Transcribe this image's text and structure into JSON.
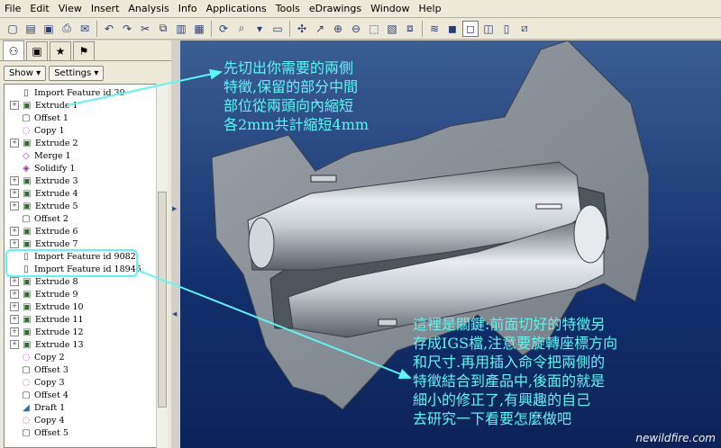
{
  "menu": [
    "File",
    "Edit",
    "View",
    "Insert",
    "Analysis",
    "Info",
    "Applications",
    "Tools",
    "eDrawings",
    "Window",
    "Help"
  ],
  "toolbar_icons": [
    "new-icon",
    "open-icon",
    "save-icon",
    "print-icon",
    "email-icon",
    "undo-icon",
    "redo-icon",
    "cut-icon",
    "copy-icon",
    "paste-icon",
    "paste-special-icon",
    "regenerate-icon",
    "find-icon",
    "select-filter-icon",
    "repaint-icon",
    "spin-center-icon",
    "orient-icon",
    "zoom-in-icon",
    "zoom-out-icon",
    "refit-icon",
    "view-manager-icon",
    "saved-views-icon",
    "layers-icon",
    "shading-icon",
    "wireframe-icon",
    "hidden-line-icon",
    "no-hidden-icon",
    "datum-planes-icon"
  ],
  "panel": {
    "tabs": [
      "model-tree-tab",
      "folder-browser-tab",
      "favorites-tab",
      "connections-tab"
    ],
    "show_button": "Show",
    "settings_button": "Settings"
  },
  "tree": [
    {
      "label": "Import Feature id 39",
      "icon": "import",
      "exp": false
    },
    {
      "label": "Extrude 1",
      "icon": "extrude",
      "exp": true
    },
    {
      "label": "Offset 1",
      "icon": "offset",
      "exp": false
    },
    {
      "label": "Copy 1",
      "icon": "copy",
      "exp": false
    },
    {
      "label": "Extrude 2",
      "icon": "extrude",
      "exp": true
    },
    {
      "label": "Merge 1",
      "icon": "merge",
      "exp": false
    },
    {
      "label": "Solidify 1",
      "icon": "solidify",
      "exp": false
    },
    {
      "label": "Extrude 3",
      "icon": "extrude",
      "exp": true
    },
    {
      "label": "Extrude 4",
      "icon": "extrude",
      "exp": true
    },
    {
      "label": "Extrude 5",
      "icon": "extrude",
      "exp": true
    },
    {
      "label": "Offset 2",
      "icon": "offset",
      "exp": false
    },
    {
      "label": "Extrude 6",
      "icon": "extrude",
      "exp": true
    },
    {
      "label": "Extrude 7",
      "icon": "extrude",
      "exp": true
    },
    {
      "label": "Import Feature id 9082",
      "icon": "import",
      "exp": false
    },
    {
      "label": "Import Feature id 18946",
      "icon": "import",
      "exp": false
    },
    {
      "label": "Extrude 8",
      "icon": "extrude",
      "exp": true
    },
    {
      "label": "Extrude 9",
      "icon": "extrude",
      "exp": true
    },
    {
      "label": "Extrude 10",
      "icon": "extrude",
      "exp": true
    },
    {
      "label": "Extrude 11",
      "icon": "extrude",
      "exp": true
    },
    {
      "label": "Extrude 12",
      "icon": "extrude",
      "exp": true
    },
    {
      "label": "Extrude 13",
      "icon": "extrude",
      "exp": true
    },
    {
      "label": "Copy 2",
      "icon": "copy",
      "exp": false
    },
    {
      "label": "Offset 3",
      "icon": "offset",
      "exp": false
    },
    {
      "label": "Copy 3",
      "icon": "copy",
      "exp": false
    },
    {
      "label": "Offset 4",
      "icon": "offset",
      "exp": false
    },
    {
      "label": "Draft 1",
      "icon": "draft",
      "exp": false
    },
    {
      "label": "Copy 4",
      "icon": "copy",
      "exp": false
    },
    {
      "label": "Offset 5",
      "icon": "offset",
      "exp": false
    }
  ],
  "annotation_top": [
    "先切出你需要的兩側",
    "特徵,保留的部分中間",
    "部位從兩頭向內縮短",
    "各2mm共計縮短4mm"
  ],
  "annotation_bottom": [
    "這裡是關鍵:前面切好的特徵另",
    "存成IGS檔,注意要旋轉座標方向",
    "和尺寸.再用插入命令把兩側的",
    "特徵結合到產品中,後面的就是",
    "細小的修正了,有興趣的自己",
    "去研究一下看要怎麼做吧"
  ],
  "watermark": "newildfire.com",
  "colors": {
    "annotation": "#5cf7f0",
    "highlight_box": "#5cf7f0",
    "viewport_top": "#3b5e93",
    "viewport_bottom": "#0c2358",
    "model_gray": "#8e949c"
  }
}
